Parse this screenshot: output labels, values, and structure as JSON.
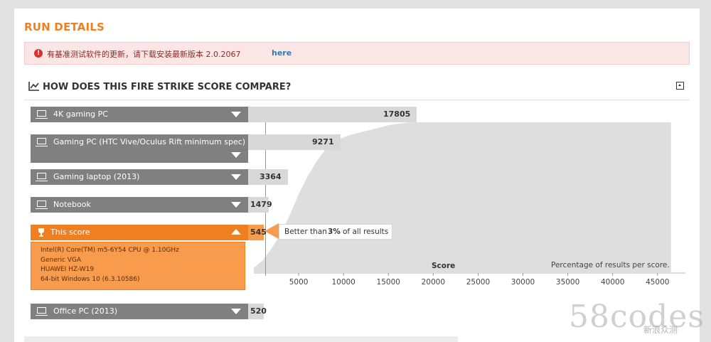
{
  "run_details": {
    "title": "RUN DETAILS"
  },
  "alert": {
    "text": "有基准测试软件的更新，请下载安装最新版本 2.0.2067",
    "link": "here"
  },
  "compare": {
    "title": "HOW DOES THIS FIRE STRIKE SCORE COMPARE?"
  },
  "rows": [
    {
      "label": "4K gaming PC",
      "score": "17805"
    },
    {
      "label": "Gaming PC (HTC Vive/Oculus Rift minimum spec)",
      "score": "9271"
    },
    {
      "label": "Gaming laptop (2013)",
      "score": "3364"
    },
    {
      "label": "Notebook",
      "score": "1479"
    },
    {
      "label": "This score",
      "score": "545"
    },
    {
      "label": "Office PC (2013)",
      "score": "520"
    }
  ],
  "this_score": {
    "details": [
      "Intel(R) Core(TM) m5-6Y54 CPU @ 1.10GHz",
      "Generic VGA",
      "HUAWEI HZ-W19",
      "64-bit Windows 10 (6.3.10586)"
    ],
    "better_prefix": "Better than",
    "better_pct": "3%",
    "better_suffix": "of all results"
  },
  "chart_data": {
    "type": "area",
    "xlabel": "Score",
    "note": "Percentage of results per score.",
    "xlim": [
      0,
      47000
    ],
    "x_ticks": [
      5000,
      10000,
      15000,
      20000,
      25000,
      30000,
      35000,
      40000,
      45000
    ],
    "x_tick_labels": [
      "5000",
      "10000",
      "15000",
      "20000",
      "25000",
      "30000",
      "35000",
      "40000",
      "45000"
    ],
    "marker_score": 545,
    "x": [
      0,
      1000,
      2000,
      3000,
      4000,
      5000,
      6000,
      7000,
      8000,
      9000,
      10000,
      11000,
      12000,
      13000,
      14000,
      15000,
      16000,
      17000,
      18000,
      20000,
      25000,
      30000,
      35000,
      40000,
      45000,
      46500
    ],
    "values": [
      3,
      8,
      16,
      26,
      38,
      52,
      64,
      74,
      82,
      87,
      90,
      92,
      93.5,
      95,
      96.5,
      98,
      99,
      99.6,
      100,
      100,
      100,
      100,
      100,
      100,
      100,
      100
    ],
    "colors": {
      "area": "#dedede",
      "marker": "#f07f21"
    }
  },
  "watermark": {
    "big": "58codes",
    "small": "新浪众测"
  },
  "colors": {
    "accent": "#f07f21",
    "row_gray": "#808080",
    "alert_bg": "#fbe6e6",
    "link": "#2a7fb5"
  }
}
